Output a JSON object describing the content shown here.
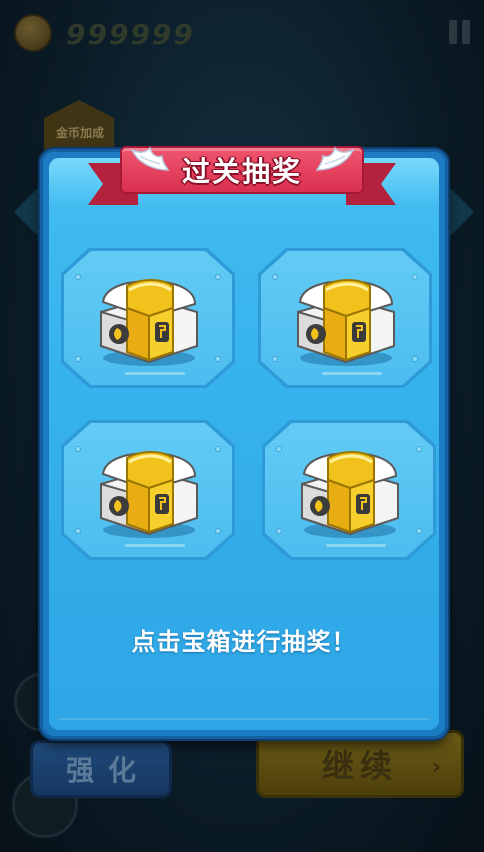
{
  "hud": {
    "coin_count": "999999",
    "bonus_label": "金币加成"
  },
  "dialog": {
    "title": "过关抽奖",
    "hint": "点击宝箱进行抽奖！",
    "chests": [
      {
        "label": "chest-1",
        "icon": "treasure-chest-icon"
      },
      {
        "label": "chest-2",
        "icon": "treasure-chest-icon"
      },
      {
        "label": "chest-3",
        "icon": "treasure-chest-icon"
      },
      {
        "label": "chest-4",
        "icon": "treasure-chest-icon"
      }
    ]
  },
  "footer": {
    "strengthen_label": "强化",
    "continue_label": "继续"
  },
  "colors": {
    "dialog_fill": "#36b2ec",
    "ribbon": "#e0405c",
    "chest_gold": "#f2c21c"
  }
}
